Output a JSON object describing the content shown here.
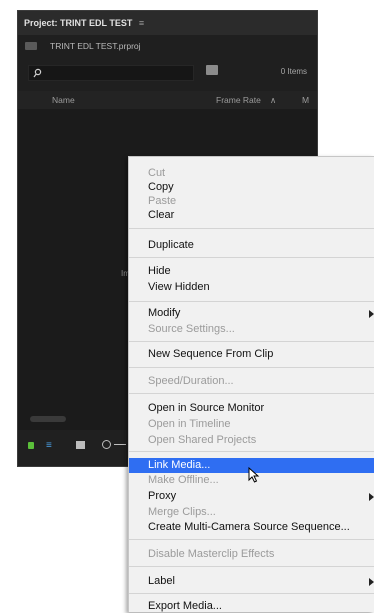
{
  "panel": {
    "title": "Project: TRINT EDL TEST",
    "menu_glyph": "≡",
    "project_file": "TRINT EDL TEST.prproj",
    "items_count": "0 Items",
    "columns": {
      "name": "Name",
      "frame_rate": "Frame Rate",
      "sort_glyph": "∧",
      "next_col": "M"
    },
    "empty_hint": "Im"
  },
  "context_menu": {
    "items": {
      "cut": "Cut",
      "copy": "Copy",
      "paste": "Paste",
      "clear": "Clear",
      "duplicate": "Duplicate",
      "hide": "Hide",
      "view_hidden": "View Hidden",
      "modify": "Modify",
      "source_settings": "Source Settings...",
      "new_sequence": "New Sequence From Clip",
      "speed_duration": "Speed/Duration...",
      "open_source_monitor": "Open in Source Monitor",
      "open_timeline": "Open in Timeline",
      "open_shared": "Open Shared Projects",
      "link_media": "Link Media...",
      "make_offline": "Make Offline...",
      "proxy": "Proxy",
      "merge_clips": "Merge Clips...",
      "multicam": "Create Multi-Camera Source Sequence...",
      "disable_effects": "Disable Masterclip Effects",
      "label": "Label",
      "export_media": "Export Media..."
    },
    "highlighted": "Link Media...",
    "highlight_color": "#2f6ef2"
  }
}
